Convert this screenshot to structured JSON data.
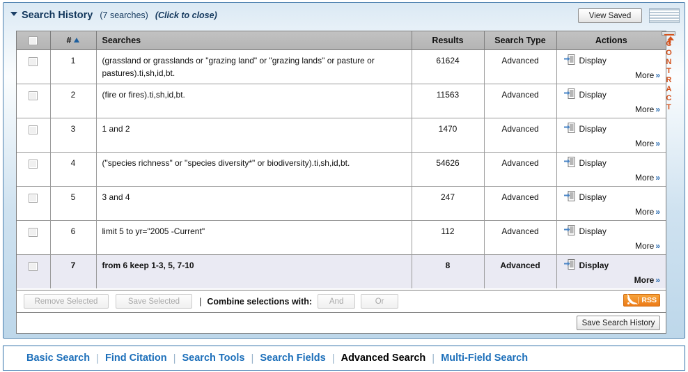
{
  "panel": {
    "title": "Search History",
    "count": "(7 searches)",
    "toggle_hint": "(Click to close)",
    "view_saved_label": "View Saved",
    "grip_icon": "drag-handle-icon",
    "caret_icon": "caret-down-icon"
  },
  "contract_tab": {
    "label": "CONTRACT",
    "icon": "collapse-up-arrow-icon"
  },
  "table": {
    "columns": {
      "checkbox": "",
      "number": "#",
      "searches": "Searches",
      "results": "Results",
      "search_type": "Search Type",
      "actions": "Actions"
    },
    "sort_indicator": "ascending-sort-triangle-icon",
    "rows": [
      {
        "num": "1",
        "search": "(grassland or grasslands or \"grazing land\" or \"grazing lands\" or pasture or pastures).ti,sh,id,bt.",
        "results": "61624",
        "type": "Advanced",
        "display": "Display",
        "more": "More",
        "more_chevron": "»",
        "highlighted": false,
        "checked": false
      },
      {
        "num": "2",
        "search": "(fire or fires).ti,sh,id,bt.",
        "results": "11563",
        "type": "Advanced",
        "display": "Display",
        "more": "More",
        "more_chevron": "»",
        "highlighted": false,
        "checked": false
      },
      {
        "num": "3",
        "search": "1 and 2",
        "results": "1470",
        "type": "Advanced",
        "display": "Display",
        "more": "More",
        "more_chevron": "»",
        "highlighted": false,
        "checked": false
      },
      {
        "num": "4",
        "search": "(\"species richness\" or \"species diversity*\" or biodiversity).ti,sh,id,bt.",
        "results": "54626",
        "type": "Advanced",
        "display": "Display",
        "more": "More",
        "more_chevron": "»",
        "highlighted": false,
        "checked": false
      },
      {
        "num": "5",
        "search": "3 and 4",
        "results": "247",
        "type": "Advanced",
        "display": "Display",
        "more": "More",
        "more_chevron": "»",
        "highlighted": false,
        "checked": false
      },
      {
        "num": "6",
        "search": "limit 5 to yr=\"2005 -Current\"",
        "results": "112",
        "type": "Advanced",
        "display": "Display",
        "more": "More",
        "more_chevron": "»",
        "highlighted": false,
        "checked": false
      },
      {
        "num": "7",
        "search": "from 6 keep 1-3, 5, 7-10",
        "results": "8",
        "type": "Advanced",
        "display": "Display",
        "more": "More",
        "more_chevron": "»",
        "highlighted": true,
        "checked": false
      }
    ]
  },
  "footer": {
    "remove_selected": "Remove Selected",
    "save_selected": "Save Selected",
    "separator": "|",
    "combine_label": "Combine selections with:",
    "and_label": "And",
    "or_label": "Or",
    "rss_label": "RSS",
    "rss_icon": "rss-feed-icon"
  },
  "savebar": {
    "save_search_history": "Save Search History"
  },
  "nav": {
    "items": [
      {
        "label": "Basic Search",
        "active": false
      },
      {
        "label": "Find Citation",
        "active": false
      },
      {
        "label": "Search Tools",
        "active": false
      },
      {
        "label": "Search Fields",
        "active": false
      },
      {
        "label": "Advanced Search",
        "active": true
      },
      {
        "label": "Multi-Field Search",
        "active": false
      }
    ],
    "separator": "|"
  },
  "colors": {
    "panel_border": "#4a7fae",
    "link_blue": "#1c6fba",
    "accent_orange": "#ec7a16",
    "contract_orange": "#d4521c",
    "row_highlight": "#eaeaf3",
    "header_grey": "#b8b8b8"
  }
}
